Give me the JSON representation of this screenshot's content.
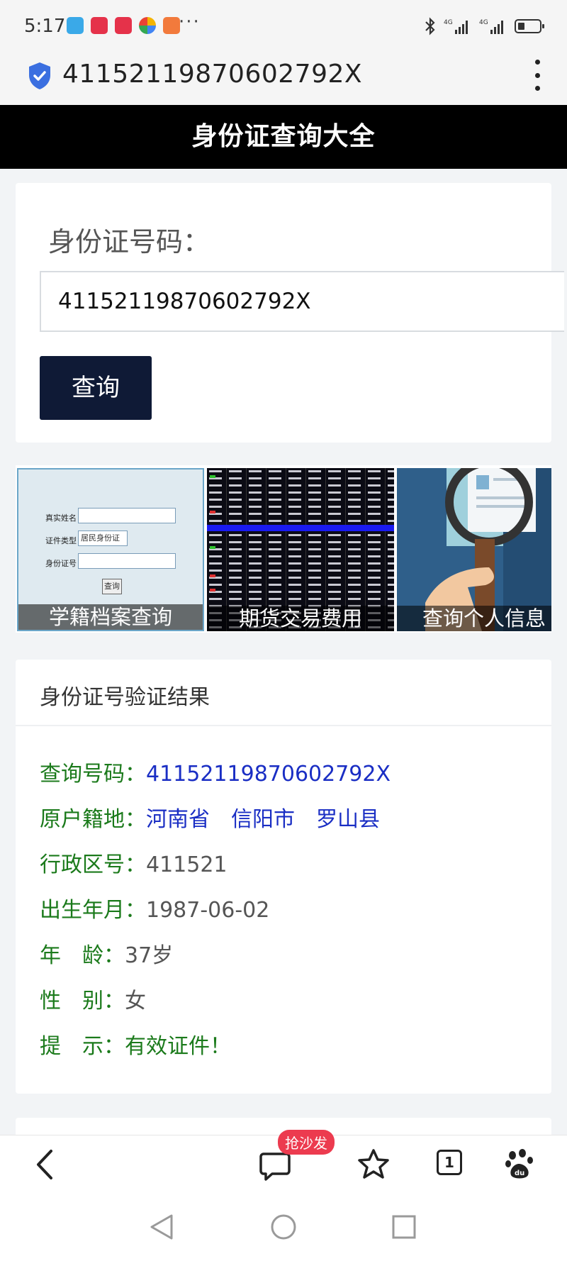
{
  "status_bar": {
    "time": "5:17",
    "more": "···",
    "signal1": "4G",
    "signal2": "4G"
  },
  "address_bar": {
    "url": "41152119870602792X"
  },
  "site": {
    "title": "身份证查询大全"
  },
  "query": {
    "label": "身份证号码：",
    "input_value": "41152119870602792X",
    "button_label": "查询"
  },
  "ads": [
    {
      "caption": "学籍档案查询"
    },
    {
      "caption": "期货交易费用"
    },
    {
      "caption": "查询个人信息"
    }
  ],
  "ad_form": {
    "name_label": "真实姓名",
    "type_label": "证件类型",
    "type_value": "居民身份证",
    "id_label": "身份证号",
    "submit": "查询"
  },
  "result": {
    "title": "身份证号验证结果",
    "rows": [
      {
        "label": "查询号码：",
        "value": "41152119870602792X"
      },
      {
        "label": "原户籍地：",
        "value": "河南省　信阳市　罗山县"
      },
      {
        "label": "行政区号：",
        "value": "411521"
      },
      {
        "label": "出生年月：",
        "value": "1987-06-02"
      },
      {
        "label": "年　龄：",
        "value": "37岁"
      },
      {
        "label": "性　别：",
        "value": "女"
      },
      {
        "label": "提　示：",
        "value": "有效证件！"
      }
    ]
  },
  "toolbar": {
    "badge": "抢沙发",
    "tab_count": "1"
  },
  "colors": {
    "header_bg": "#000000",
    "button_bg": "#0f1a36",
    "label_green": "#1b7a1b",
    "value_blue": "#1a2ec4",
    "badge_red": "#ec3b4f"
  }
}
